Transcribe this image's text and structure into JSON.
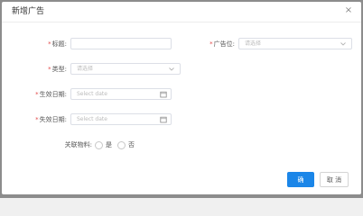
{
  "dialog": {
    "title": "新增广告",
    "close_label": "×"
  },
  "form": {
    "title_field": {
      "required_mark": "*",
      "label": "标题:",
      "value": "",
      "placeholder": ""
    },
    "position_field": {
      "required_mark": "*",
      "label": "广告位:",
      "value": "",
      "placeholder": "请选择"
    },
    "type_field": {
      "required_mark": "*",
      "label": "类型:",
      "value": "",
      "placeholder": "请选择"
    },
    "start_date_field": {
      "required_mark": "*",
      "label": "生效日期:",
      "value": "",
      "placeholder": "Select date"
    },
    "end_date_field": {
      "required_mark": "*",
      "label": "失效日期:",
      "value": "",
      "placeholder": "Select date"
    },
    "link_material": {
      "label": "关联物料:",
      "options": [
        "是",
        "否"
      ],
      "selected": null
    }
  },
  "footer": {
    "ok_label": "确 定",
    "cancel_label": "取 消"
  },
  "colors": {
    "primary": "#1b86e8",
    "required": "#e24b4b",
    "border": "#dcdfe6"
  },
  "icons": {
    "close": "close-icon",
    "select": "chevron-down-icon",
    "date": "calendar-icon"
  }
}
